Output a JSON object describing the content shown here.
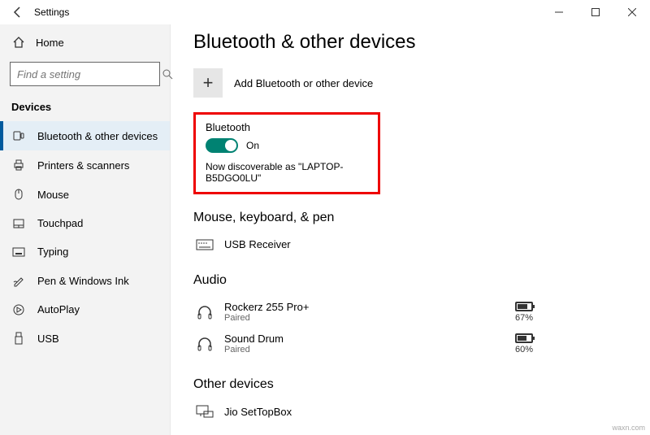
{
  "window": {
    "title": "Settings"
  },
  "sidebar": {
    "home": "Home",
    "search_placeholder": "Find a setting",
    "section": "Devices",
    "items": [
      {
        "label": "Bluetooth & other devices"
      },
      {
        "label": "Printers & scanners"
      },
      {
        "label": "Mouse"
      },
      {
        "label": "Touchpad"
      },
      {
        "label": "Typing"
      },
      {
        "label": "Pen & Windows Ink"
      },
      {
        "label": "AutoPlay"
      },
      {
        "label": "USB"
      }
    ]
  },
  "main": {
    "heading": "Bluetooth & other devices",
    "add_label": "Add Bluetooth or other device",
    "bluetooth": {
      "title": "Bluetooth",
      "state": "On",
      "discoverable": "Now discoverable as \"LAPTOP-B5DGO0LU\""
    },
    "sections": {
      "mkp": {
        "title": "Mouse, keyboard, & pen",
        "items": [
          {
            "name": "USB Receiver"
          }
        ]
      },
      "audio": {
        "title": "Audio",
        "items": [
          {
            "name": "Rockerz 255 Pro+",
            "status": "Paired",
            "battery": "67%",
            "fill": 67
          },
          {
            "name": "Sound Drum",
            "status": "Paired",
            "battery": "60%",
            "fill": 60
          }
        ]
      },
      "other": {
        "title": "Other devices",
        "items": [
          {
            "name": "Jio SetTopBox"
          }
        ]
      }
    }
  },
  "watermark": "waxn.com"
}
